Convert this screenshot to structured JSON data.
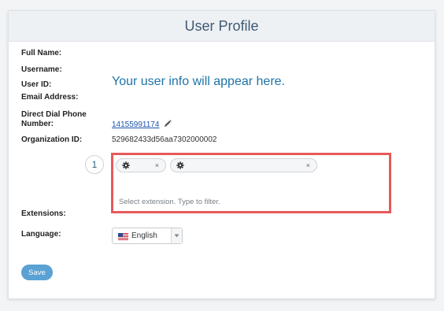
{
  "header": {
    "title": "User Profile"
  },
  "labels": {
    "full_name": "Full Name:",
    "username": "Username:",
    "user_id": "User ID:",
    "email": "Email Address:",
    "direct_dial_1": "Direct Dial Phone",
    "direct_dial_2": "Number:",
    "org_id": "Organization ID:",
    "extensions": "Extensions:",
    "language": "Language:"
  },
  "info_message": "Your user info will appear here.",
  "phone_number": "14155991174",
  "organization_id": "529682433d56aa7302000002",
  "step_number": "1",
  "extensions": {
    "tags": [
      {
        "icon": "gear-icon",
        "remove": "×"
      },
      {
        "icon": "gear-icon",
        "remove": "×"
      }
    ],
    "placeholder": "Select extension. Type to filter."
  },
  "language": {
    "selected": "English",
    "flag": "us-flag-icon"
  },
  "save_label": "Save",
  "colors": {
    "header_bg": "#eef1f4",
    "title": "#3e5a75",
    "info": "#1e73a6",
    "link": "#1c55b0",
    "highlight": "#e8595a",
    "save_button": "#5aa1d4"
  }
}
